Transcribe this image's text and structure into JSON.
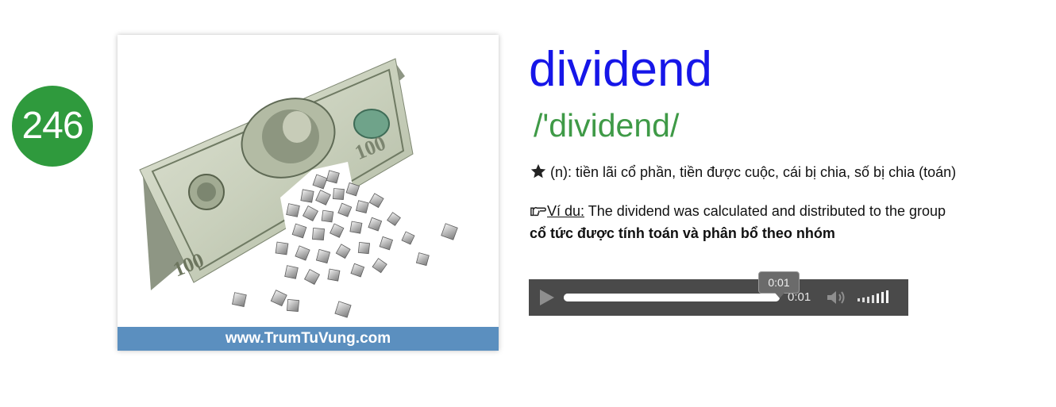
{
  "badge": {
    "number": "246"
  },
  "image": {
    "watermark": "www.TrumTuVung.com",
    "illustration": "hundred-dollar-bill-breaking-into-cubes",
    "bill_denomination": "100"
  },
  "entry": {
    "word": "dividend",
    "phonetic": "/'dividend/",
    "meaning_icon": "star-icon",
    "meaning": "(n): tiền lãi cổ phần, tiền được cuộc, cái bị chia, số bị chia (toán)",
    "example_icon": "pointing-hand-icon",
    "example_label": "Ví du:",
    "example_en": " The dividend was calculated and distributed to the group",
    "example_vi": "cổ tức được tính toán và phân bổ theo nhóm"
  },
  "player": {
    "current_time": "0:01",
    "tooltip_time": "0:01",
    "progress": 1.0,
    "icons": [
      "play-icon",
      "volume-icon",
      "volume-level-icon"
    ]
  },
  "colors": {
    "badge": "#2f9a3d",
    "word": "#1616e8",
    "phonetic": "#3f9a47",
    "watermark_bar": "#5b8fbf",
    "player_bg": "#4a4a4a"
  }
}
